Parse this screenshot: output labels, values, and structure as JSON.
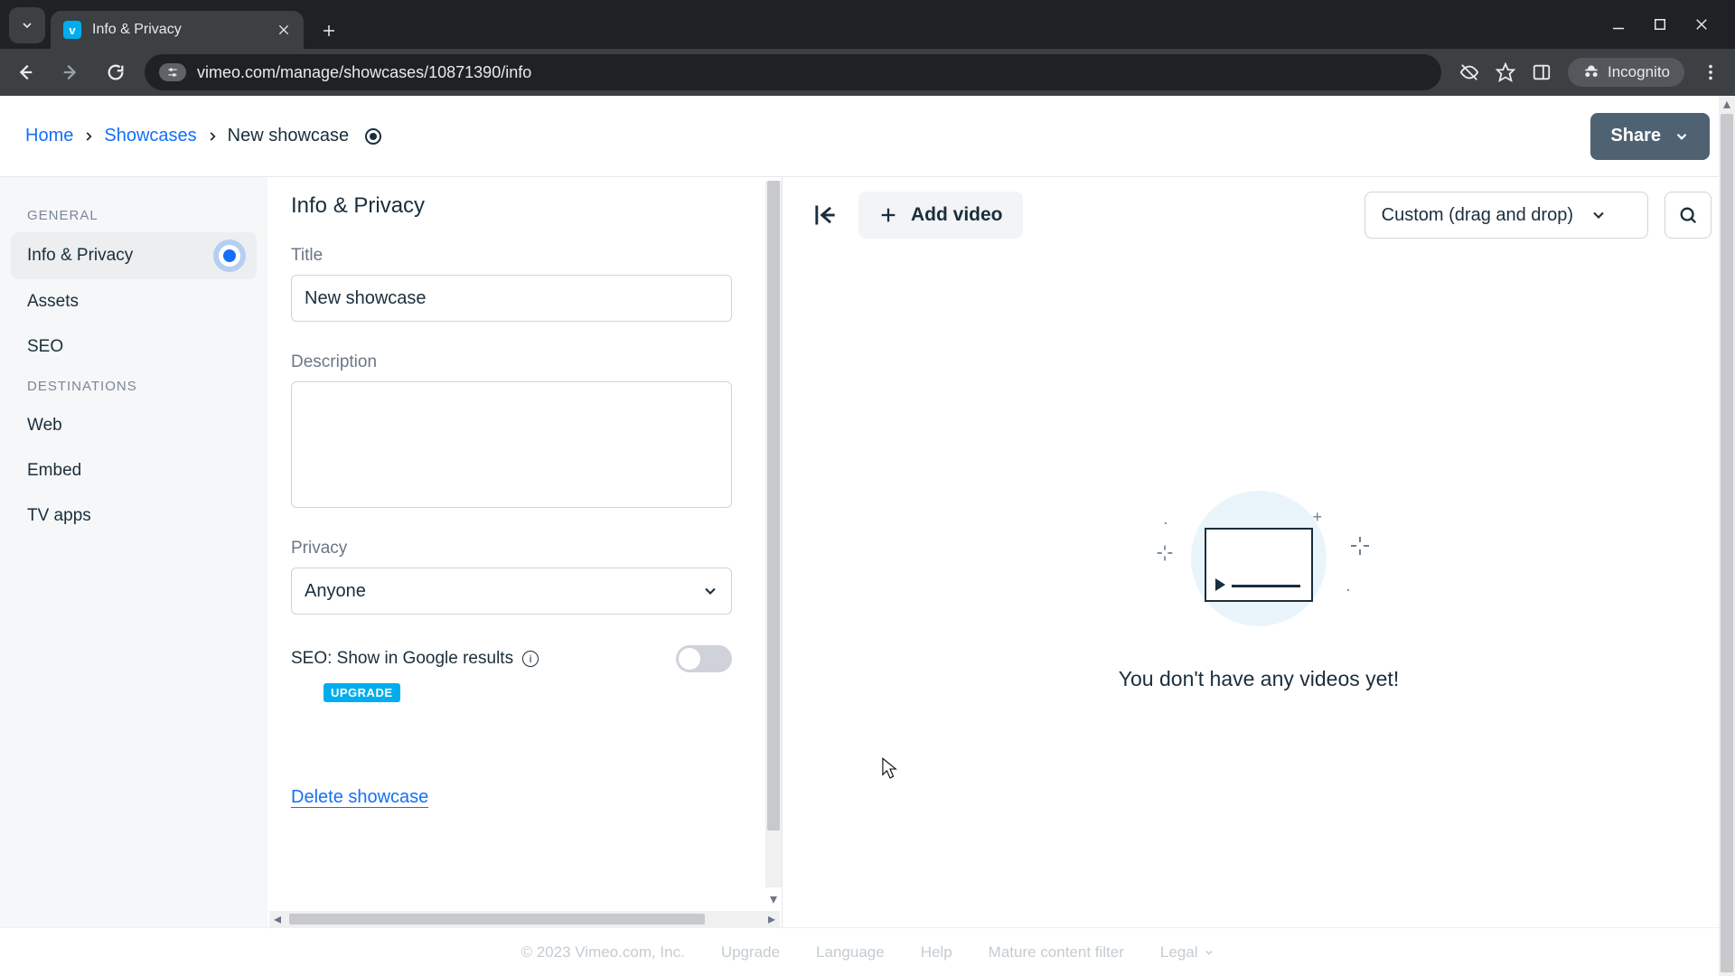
{
  "browser": {
    "tab_title": "Info & Privacy",
    "url": "vimeo.com/manage/showcases/10871390/info",
    "incognito_label": "Incognito"
  },
  "topbar": {
    "breadcrumb_home": "Home",
    "breadcrumb_showcases": "Showcases",
    "breadcrumb_current": "New showcase",
    "share_label": "Share"
  },
  "sidebar": {
    "section_general": "GENERAL",
    "item_info_privacy": "Info & Privacy",
    "item_assets": "Assets",
    "item_seo": "SEO",
    "section_destinations": "DESTINATIONS",
    "item_web": "Web",
    "item_embed": "Embed",
    "item_tv_apps": "TV apps"
  },
  "panel": {
    "heading": "Info & Privacy",
    "title_label": "Title",
    "title_value": "New showcase",
    "description_label": "Description",
    "description_value": "",
    "privacy_label": "Privacy",
    "privacy_value": "Anyone",
    "seo_label": "SEO: Show in Google results",
    "upgrade_label": "UPGRADE",
    "delete_label": "Delete showcase"
  },
  "right": {
    "add_video_label": "Add video",
    "sort_label": "Custom (drag and drop)",
    "empty_text": "You don't have any videos yet!"
  },
  "footer": {
    "copyright": "© 2023 Vimeo.com, Inc.",
    "upgrade": "Upgrade",
    "language": "Language",
    "help": "Help",
    "mature": "Mature content filter",
    "legal": "Legal"
  }
}
